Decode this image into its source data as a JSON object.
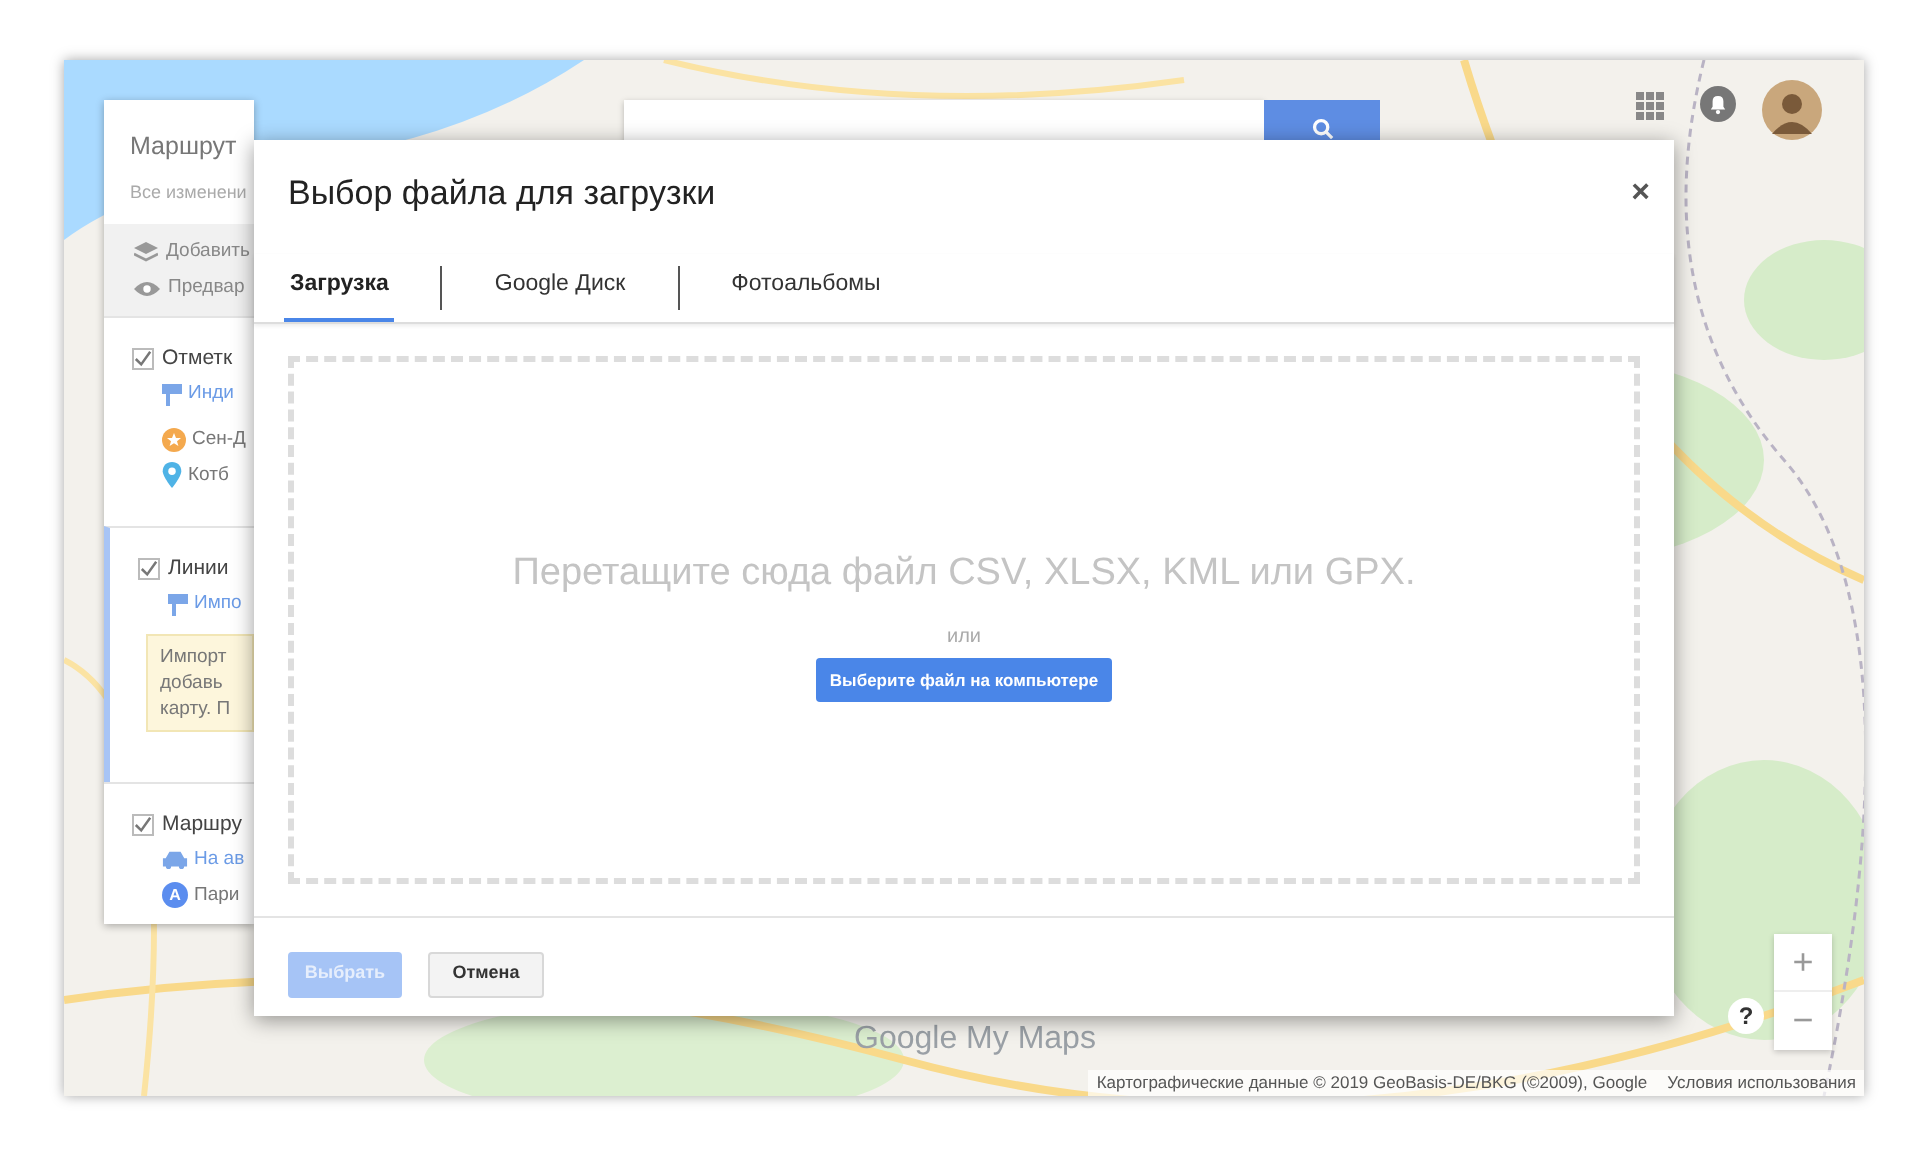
{
  "side_panel": {
    "title": "Маршрут",
    "subtitle": "Все изменени",
    "actions": [
      "Добавить",
      "Предвар"
    ],
    "layers": [
      {
        "name": "Отметк",
        "checked": true,
        "active": false,
        "import_link": "Инди",
        "items": [
          {
            "label": "Сен-Д",
            "kind": "star"
          },
          {
            "label": "Котб",
            "kind": "pin"
          }
        ]
      },
      {
        "name": "Линии",
        "checked": true,
        "active": true,
        "import_link": "Импо",
        "note": [
          "Импорт",
          "добавь",
          "карту. П"
        ]
      },
      {
        "name": "Маршру",
        "checked": true,
        "active": false,
        "items": [
          {
            "label": "На ав",
            "kind": "car"
          },
          {
            "label": "Пари",
            "kind": "letter",
            "letter": "A"
          }
        ]
      }
    ]
  },
  "dialog": {
    "title": "Выбор файла для загрузки",
    "close": "×",
    "tabs": [
      {
        "label": "Загрузка",
        "selected": true
      },
      {
        "label": "Google Диск",
        "selected": false
      },
      {
        "label": "Фотоальбомы",
        "selected": false
      }
    ],
    "drop_hint": "Перетащите сюда файл CSV, XLSX, KML или GPX.",
    "or": "или",
    "pick_button": "Выберите файл на компьютере",
    "buttons": [
      {
        "label": "Выбрать",
        "kind": "primary",
        "disabled": true
      },
      {
        "label": "Отмена",
        "kind": "secondary",
        "disabled": false
      }
    ]
  },
  "map": {
    "logo": "Google My Maps",
    "help": "?",
    "zoom_in": "+",
    "zoom_out": "−",
    "attribution": "Картографические данные © 2019 GeoBasis-DE/BKG (©2009), Google",
    "terms": "Условия использования"
  }
}
